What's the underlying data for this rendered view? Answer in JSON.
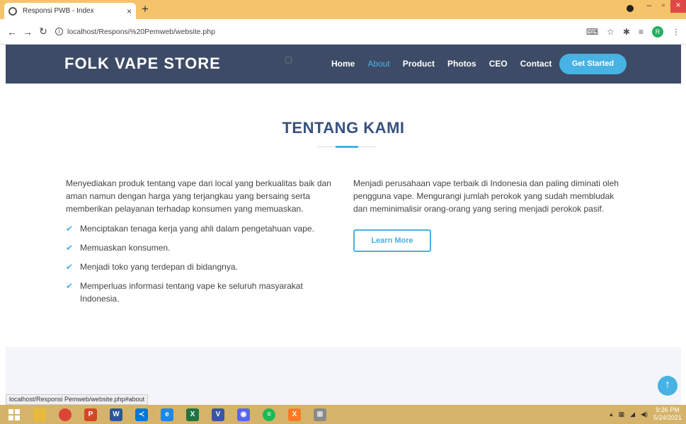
{
  "browser": {
    "tab_title": "Responsi PWB - Index",
    "tab_close": "×",
    "new_tab": "+",
    "url": "localhost/Responsi%20Pemweb/website.php",
    "profile_initial": "R",
    "status_url": "localhost/Responsi Pemweb/website.php#about"
  },
  "site": {
    "brand": "FOLK VAPE STORE",
    "nav": [
      "Home",
      "About",
      "Product",
      "Photos",
      "CEO",
      "Contact"
    ],
    "active_nav": "About",
    "cta_label": "Get Started"
  },
  "about": {
    "title": "TENTANG KAMI",
    "left_paragraph": "Menyediakan produk tentang vape dari local yang berkualitas baik dan aman namun dengan harga yang terjangkau yang bersaing serta memberikan pelayanan terhadap konsumen yang memuaskan.",
    "checklist": [
      "Menciptakan tenaga kerja yang ahli dalam pengetahuan vape.",
      "Memuaskan konsumen.",
      "Menjadi toko yang terdepan di bidangnya.",
      "Memperluas informasi tentang vape ke seluruh masyarakat Indonesia."
    ],
    "right_paragraph": "Menjadi perusahaan vape terbaik di Indonesia dan paling diminati oleh pengguna vape. Mengurangi jumlah perokok yang sudah membludak dan meminimalisir orang-orang yang sering menjadi perokok pasif.",
    "learn_more": "Learn More"
  },
  "taskbar": {
    "time": "9:26 PM",
    "date": "5/24/2021"
  },
  "colors": {
    "accent": "#47b2e4",
    "header_bg": "#3d4b67",
    "title": "#37517e"
  }
}
